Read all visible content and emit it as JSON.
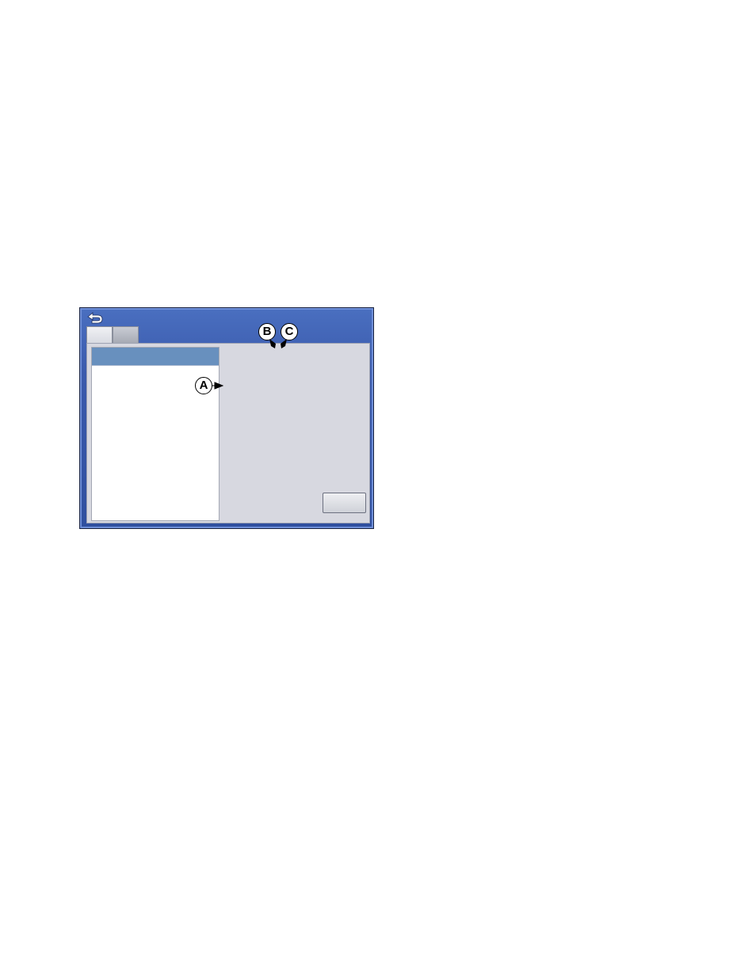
{
  "window": {
    "back_icon": "back-arrow-icon",
    "tabs": [
      {
        "label": ""
      },
      {
        "label": ""
      }
    ],
    "list": {
      "items": [
        {
          "label": ""
        }
      ]
    },
    "ok_label": ""
  },
  "callouts": {
    "a": "A",
    "b": "B",
    "c": "C"
  },
  "colors": {
    "title_bar": "#3a5aac",
    "content_bg": "#d7d8e0",
    "selected_row": "#6890be"
  }
}
